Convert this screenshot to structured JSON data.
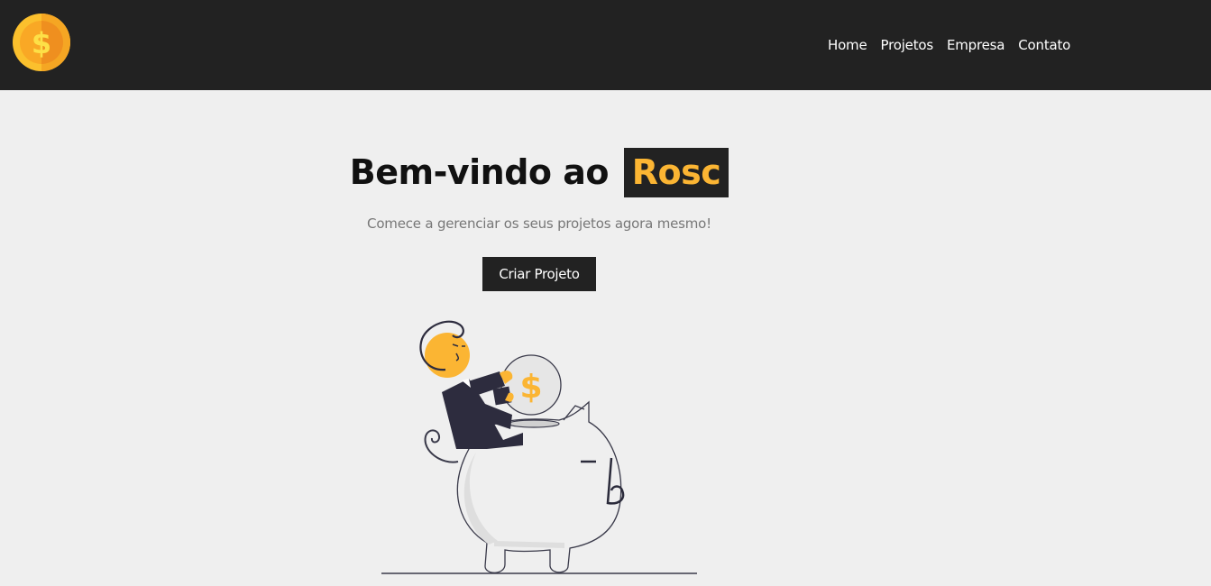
{
  "brand": {
    "logo_icon": "dollar-coin-icon",
    "logo_symbol": "$"
  },
  "nav": {
    "items": [
      {
        "label": "Home"
      },
      {
        "label": "Projetos"
      },
      {
        "label": "Empresa"
      },
      {
        "label": "Contato"
      }
    ]
  },
  "hero": {
    "title_prefix": "Bem-vindo ao",
    "title_brand": "Rosc",
    "subtitle": "Comece a gerenciar os seus projetos agora mesmo!",
    "cta_label": "Criar Projeto",
    "illustration_icon": "piggy-bank-illustration",
    "coin_symbol": "$"
  },
  "colors": {
    "navbar_bg": "#222222",
    "page_bg": "#efefef",
    "accent": "#fbb533",
    "text_dark": "#111111",
    "text_muted": "#777777"
  }
}
